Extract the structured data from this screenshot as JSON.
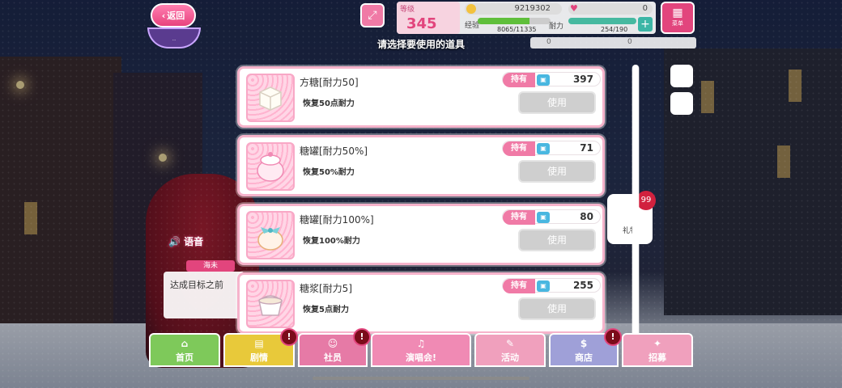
{
  "top_bar": {
    "back_label": "返回",
    "emblem_text": "...",
    "rank_label": "等级",
    "rank_value": "345",
    "coins": "9219302",
    "gems": "0",
    "exp_label": "经验",
    "exp_value": "8065/11335",
    "exp_fraction": 0.71,
    "stamina_label": "耐力",
    "stamina_value": "254/190",
    "stamina_fraction": 1.0,
    "plus_label": "+",
    "menu_label": "菜单",
    "sub_left": "0",
    "sub_right": "0"
  },
  "prompt": "请选择要使用的道具",
  "items": [
    {
      "name": "方糖[耐力50]",
      "desc": "恢复50点耐力",
      "own_label": "持有",
      "count": "397",
      "use_label": "使用",
      "icon": "sugar-cube-icon"
    },
    {
      "name": "糖罐[耐力50%]",
      "desc": "恢复50%耐力",
      "own_label": "持有",
      "count": "71",
      "use_label": "使用",
      "icon": "sugar-jar-icon"
    },
    {
      "name": "糖罐[耐力100%]",
      "desc": "恢复100%耐力",
      "own_label": "持有",
      "count": "80",
      "use_label": "使用",
      "icon": "sugar-jar-ribbon-icon"
    },
    {
      "name": "糖浆[耐力5]",
      "desc": "恢复5点耐力",
      "own_label": "持有",
      "count": "255",
      "use_label": "使用",
      "icon": "syrup-icon"
    }
  ],
  "voice_label": "语音",
  "chat": {
    "speaker": "海未",
    "text": "达成目标之前"
  },
  "gift": {
    "label": "礼物",
    "badge": "99"
  },
  "nav": [
    {
      "label": "首页",
      "icon": "home-icon",
      "color": "#7ec95a"
    },
    {
      "label": "剧情",
      "icon": "story-icon",
      "color": "#e8c93a"
    },
    {
      "label": "社员",
      "icon": "members-icon",
      "color": "#e67aa6"
    },
    {
      "label": "演唱会!",
      "icon": "live-icon",
      "color": "#f08ab4"
    },
    {
      "label": "活动",
      "icon": "event-icon",
      "color": "#f0a0bd"
    },
    {
      "label": "商店",
      "icon": "shop-icon",
      "color": "#9fa0d8"
    },
    {
      "label": "招募",
      "icon": "scout-icon",
      "color": "#f0a0bd"
    }
  ],
  "colors": {
    "accent": "#e2457d",
    "card_border": "#f6b3cb"
  }
}
